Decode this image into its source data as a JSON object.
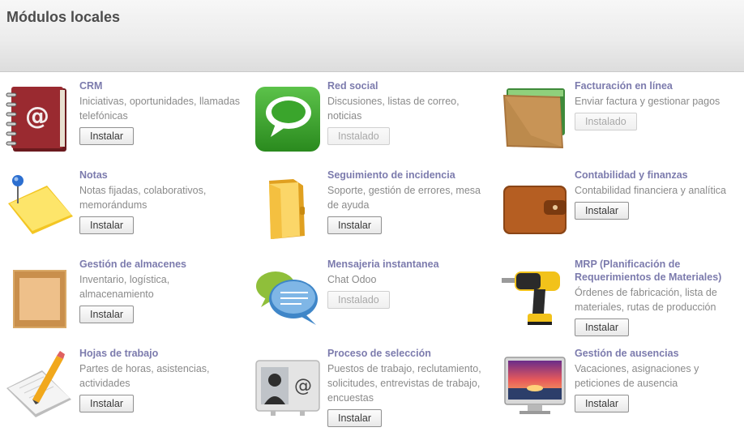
{
  "header": {
    "title": "Módulos locales"
  },
  "modules": [
    {
      "title": "CRM",
      "description": "Iniciativas, oportunidades, llamadas telefónicas",
      "button": "Instalar"
    },
    {
      "title": "Red social",
      "description": "Discusiones, listas de correo, noticias",
      "button": "Instalado"
    },
    {
      "title": "Facturación en línea",
      "description": "Enviar factura y gestionar pagos",
      "button": "Instalado"
    },
    {
      "title": "Notas",
      "description": "Notas fijadas, colaborativos, memorándums",
      "button": "Instalar"
    },
    {
      "title": "Seguimiento de incidencia",
      "description": "Soporte, gestión de errores, mesa de ayuda",
      "button": "Instalar"
    },
    {
      "title": "Contabilidad y finanzas",
      "description": "Contabilidad financiera y analítica",
      "button": "Instalar"
    },
    {
      "title": "Gestión de almacenes",
      "description": "Inventario, logística, almacenamiento",
      "button": "Instalar"
    },
    {
      "title": "Mensajeria instantanea",
      "description": "Chat Odoo",
      "button": "Instalado"
    },
    {
      "title": "MRP (Planificación de Requerimientos de Materiales)",
      "description": "Órdenes de fabricación, lista de materiales, rutas de producción",
      "button": "Instalar"
    },
    {
      "title": "Hojas de trabajo",
      "description": "Partes de horas, asistencias, actividades",
      "button": "Instalar"
    },
    {
      "title": "Proceso de selección",
      "description": "Puestos de trabajo, reclutamiento, solicitudes, entrevistas de trabajo, encuestas",
      "button": "Instalar"
    },
    {
      "title": "Gestión de ausencias",
      "description": "Vacaciones, asignaciones y peticiones de ausencia",
      "button": "Instalar"
    }
  ],
  "icons": [
    "address-book-icon",
    "chat-bubble-icon",
    "wallet-icon",
    "sticky-note-icon",
    "folder-icon",
    "brown-wallet-icon",
    "wooden-crate-icon",
    "speech-bubbles-icon",
    "power-drill-icon",
    "pencil-paper-icon",
    "contact-card-icon",
    "monitor-sunset-icon"
  ],
  "colors": {
    "title": "#7c7bad",
    "description": "#8a8a8a",
    "header_text": "#4c4c4c"
  }
}
